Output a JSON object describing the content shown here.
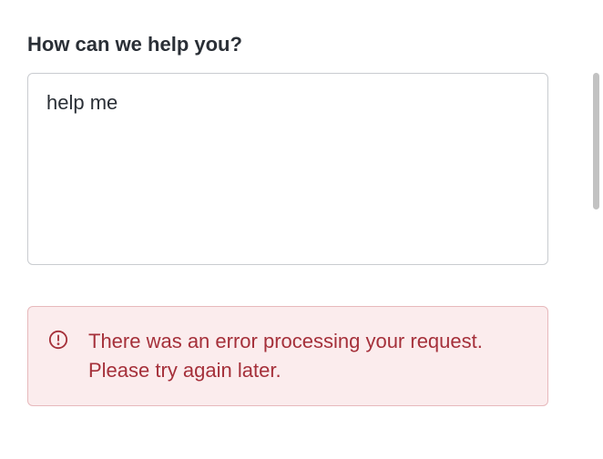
{
  "form": {
    "label": "How can we help you?",
    "textarea_value": "help me",
    "textarea_placeholder": ""
  },
  "alert": {
    "message": "There was an error processing your request. Please try again later.",
    "icon_name": "alert-circle-icon"
  },
  "colors": {
    "error_text": "#a5303a",
    "error_bg": "#fbeced",
    "error_border": "#e7b9bc",
    "text_primary": "#2a2f36",
    "input_border": "#c9ccd0"
  }
}
